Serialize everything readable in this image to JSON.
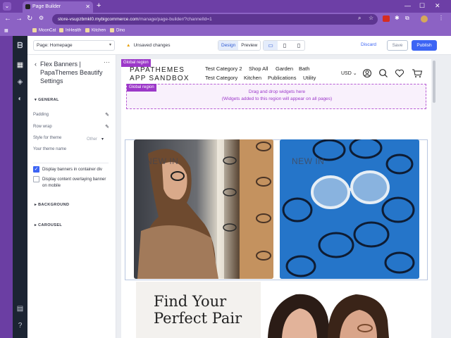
{
  "browser": {
    "tab_title": "Page Builder",
    "url_host": "store-vsupzbmkl0.mybigcommerce.com",
    "url_path": "/manage/page-builder/?channelId=1",
    "bookmarks": [
      "MoonCat",
      "InHealth",
      "Kitchen",
      "Dino"
    ]
  },
  "topbar": {
    "page_select": "Page: Homepage",
    "unsaved": "Unsaved changes",
    "mode_design": "Design",
    "mode_preview": "Preview",
    "discard": "Discard",
    "save": "Save",
    "publish": "Publish"
  },
  "sidebar": {
    "title": "Flex Banners | PapaThemes Beautify Settings",
    "section_general": "GENERAL",
    "padding": "Padding",
    "row_wrap": "Row wrap",
    "style_for_theme": "Style for theme",
    "style_value": "Other",
    "theme_name": "Your theme name",
    "display_banners": "Display banners in container div",
    "display_overlay": "Display content overlaying banner on mobile",
    "section_background": "BACKGROUND",
    "section_carousel": "CAROUSEL"
  },
  "canvas": {
    "global_region": "Global region",
    "logo_line1": "PAPATHEMES",
    "logo_line2": "APP SANDBOX",
    "menu_row1": [
      "Test Category 2",
      "Shop All",
      "Garden",
      "Bath"
    ],
    "menu_row2": [
      "Test Category",
      "Kitchen",
      "Publications",
      "Utility"
    ],
    "currency": "USD",
    "dropzone_line1": "Drag and drop widgets here",
    "dropzone_line2": "(Widgets added to this region will appear on all pages)",
    "banner_left_label": "NEW IN",
    "banner_right_label": "NEW IN",
    "promo_title": "Find Your Perfect Pair"
  },
  "colors": {
    "chrome": "#6d3fa6",
    "accent": "#3c64f4",
    "global_region": "#9c38c9"
  }
}
